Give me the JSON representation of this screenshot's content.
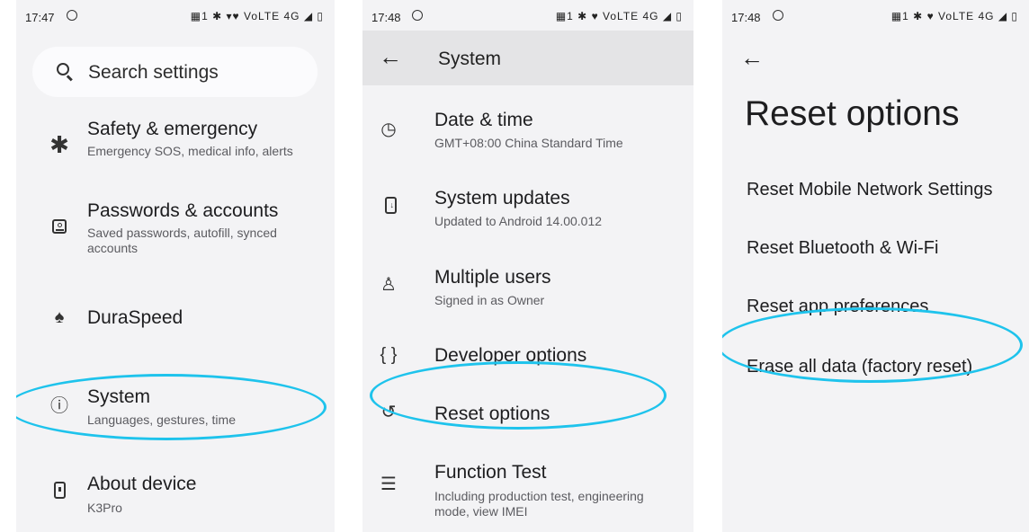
{
  "screens": [
    {
      "status": {
        "time": "17:47",
        "icons": "▦1 ✱ ▾♥ VoLTE 4G ◢ ▯"
      },
      "search": {
        "placeholder": "Search settings"
      },
      "items": [
        {
          "title": "Safety & emergency",
          "subtitle": "Emergency SOS, medical info, alerts",
          "icon": "asterisk-icon",
          "glyph": "✱"
        },
        {
          "title": "Passwords & accounts",
          "subtitle": "Saved passwords, autofill, synced accounts",
          "icon": "account-box-icon",
          "glyph": ""
        },
        {
          "title": "DuraSpeed",
          "subtitle": "",
          "icon": "rocket-icon",
          "glyph": "♠"
        },
        {
          "title": "System",
          "subtitle": "Languages, gestures, time",
          "icon": "info-icon",
          "glyph": "ⓘ"
        },
        {
          "title": "About device",
          "subtitle": "K3Pro",
          "icon": "device-icon",
          "glyph": ""
        }
      ]
    },
    {
      "status": {
        "time": "17:48",
        "icons": "▦1 ✱ ♥ VoLTE 4G ◢ ▯"
      },
      "appbar": {
        "back": "←",
        "title": "System"
      },
      "items": [
        {
          "title": "Date & time",
          "subtitle": "GMT+08:00 China Standard Time",
          "icon": "clock-icon",
          "glyph": "◷"
        },
        {
          "title": "System updates",
          "subtitle": "Updated to Android 14.00.012",
          "icon": "system-update-icon",
          "glyph": ""
        },
        {
          "title": "Multiple users",
          "subtitle": "Signed in as Owner",
          "icon": "person-icon",
          "glyph": "♙"
        },
        {
          "title": "Developer options",
          "subtitle": "",
          "icon": "braces-icon",
          "glyph": "{ }"
        },
        {
          "title": "Reset options",
          "subtitle": "",
          "icon": "history-icon",
          "glyph": "↺"
        },
        {
          "title": "Function Test",
          "subtitle": "Including production test, engineering mode, view IMEI",
          "icon": "list-icon",
          "glyph": "☰"
        }
      ]
    },
    {
      "status": {
        "time": "17:48",
        "icons": "▦1 ✱ ♥ VoLTE 4G ◢ ▯"
      },
      "back": "←",
      "title": "Reset options",
      "options": [
        "Reset Mobile Network Settings",
        "Reset Bluetooth & Wi-Fi",
        "Reset app preferences",
        "Erase all data (factory reset)"
      ]
    }
  ],
  "colors": {
    "highlight": "#1ec3ec",
    "screen_bg": "#f3f3f5",
    "appbar_bg": "#e4e4e6"
  }
}
